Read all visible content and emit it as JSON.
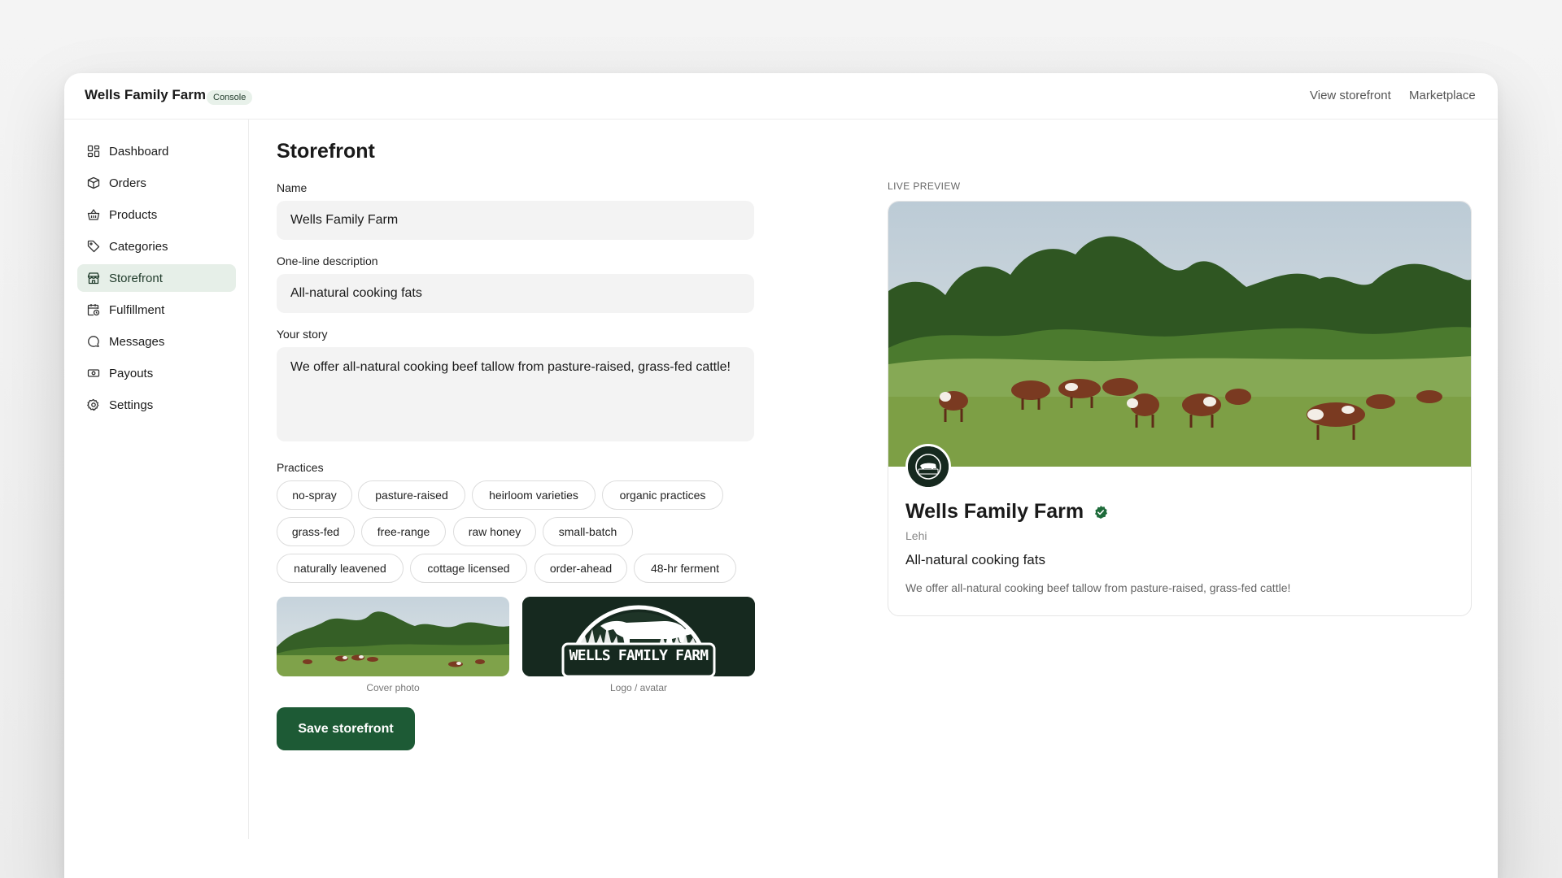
{
  "app": {
    "brand": "Wells Family Farm",
    "badge": "Console",
    "links": [
      "View storefront",
      "Marketplace"
    ]
  },
  "sidebar": {
    "items": [
      {
        "label": "Dashboard",
        "icon": "grid-icon"
      },
      {
        "label": "Orders",
        "icon": "box-icon"
      },
      {
        "label": "Products",
        "icon": "basket-icon"
      },
      {
        "label": "Categories",
        "icon": "tag-icon"
      },
      {
        "label": "Storefront",
        "icon": "store-icon",
        "active": true
      },
      {
        "label": "Fulfillment",
        "icon": "calendar-clock-icon"
      },
      {
        "label": "Messages",
        "icon": "chat-icon"
      },
      {
        "label": "Payouts",
        "icon": "banknote-icon"
      },
      {
        "label": "Settings",
        "icon": "gear-icon"
      }
    ]
  },
  "form": {
    "title": "Storefront",
    "name_label": "Name",
    "name_value": "Wells Family Farm",
    "desc_label": "One-line description",
    "desc_value": "All-natural cooking fats",
    "story_label": "Your story",
    "story_value": "We offer all-natural cooking beef tallow from pasture-raised, grass-fed cattle!",
    "practices_label": "Practices",
    "practices": [
      "no-spray",
      "pasture-raised",
      "heirloom varieties",
      "organic practices",
      "grass-fed",
      "free-range",
      "raw honey",
      "small-batch",
      "naturally leavened",
      "cottage licensed",
      "order-ahead",
      "48-hr ferment"
    ],
    "cover_caption": "Cover photo",
    "logo_caption": "Logo / avatar",
    "logo_text": "WELLS FAMILY FARM",
    "save_label": "Save storefront"
  },
  "preview": {
    "label": "LIVE PREVIEW",
    "name": "Wells Family Farm",
    "location": "Lehi",
    "description": "All-natural cooking fats",
    "story": "We offer all-natural cooking beef tallow from pasture-raised, grass-fed cattle!"
  },
  "colors": {
    "accent": "#1d5a35",
    "active_nav_bg": "#e6efe8",
    "logo_bg": "#16291f",
    "verified": "#1e6b3a"
  }
}
